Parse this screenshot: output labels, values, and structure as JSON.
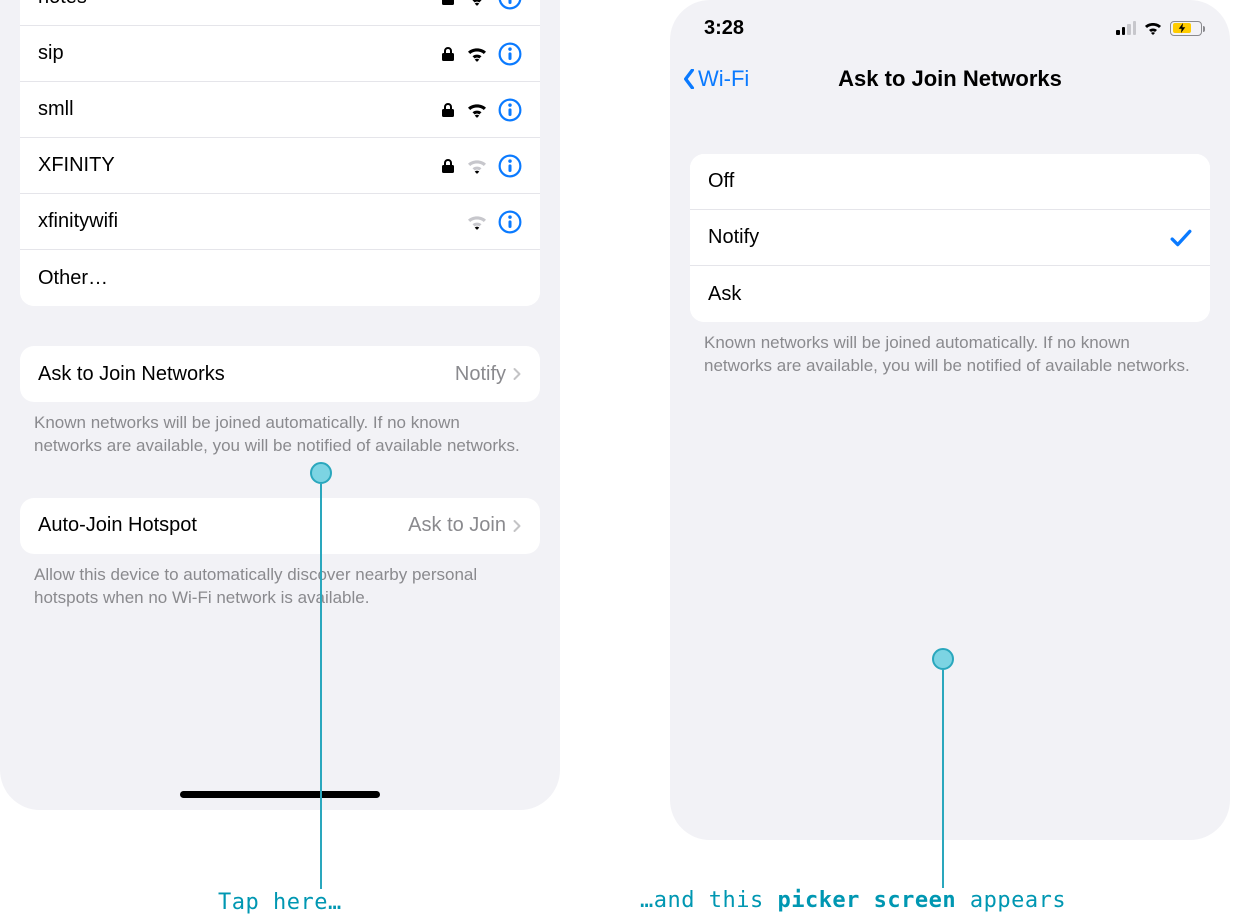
{
  "left": {
    "networks": [
      {
        "name": "notes",
        "locked": true,
        "strength": "strong"
      },
      {
        "name": "sip",
        "locked": true,
        "strength": "strong"
      },
      {
        "name": "smll",
        "locked": true,
        "strength": "strong"
      },
      {
        "name": "XFINITY",
        "locked": true,
        "strength": "weak"
      },
      {
        "name": "xfinitywifi",
        "locked": false,
        "strength": "weak"
      }
    ],
    "other_label": "Other…",
    "ask_join": {
      "label": "Ask to Join Networks",
      "value": "Notify",
      "footer": "Known networks will be joined automatically. If no known networks are available, you will be notified of available networks."
    },
    "auto_hotspot": {
      "label": "Auto-Join Hotspot",
      "value": "Ask to Join",
      "footer": "Allow this device to automatically discover nearby personal hotspots when no Wi-Fi network is available."
    }
  },
  "right": {
    "time": "3:28",
    "back_label": "Wi-Fi",
    "title": "Ask to Join Networks",
    "options": [
      {
        "label": "Off",
        "selected": false
      },
      {
        "label": "Notify",
        "selected": true
      },
      {
        "label": "Ask",
        "selected": false
      }
    ],
    "footer": "Known networks will be joined automatically. If no known networks are available, you will be notified of available networks."
  },
  "annotations": {
    "left_text": "Tap here…",
    "right_prefix": "…and this ",
    "right_bold": "picker screen",
    "right_suffix": " appears"
  }
}
